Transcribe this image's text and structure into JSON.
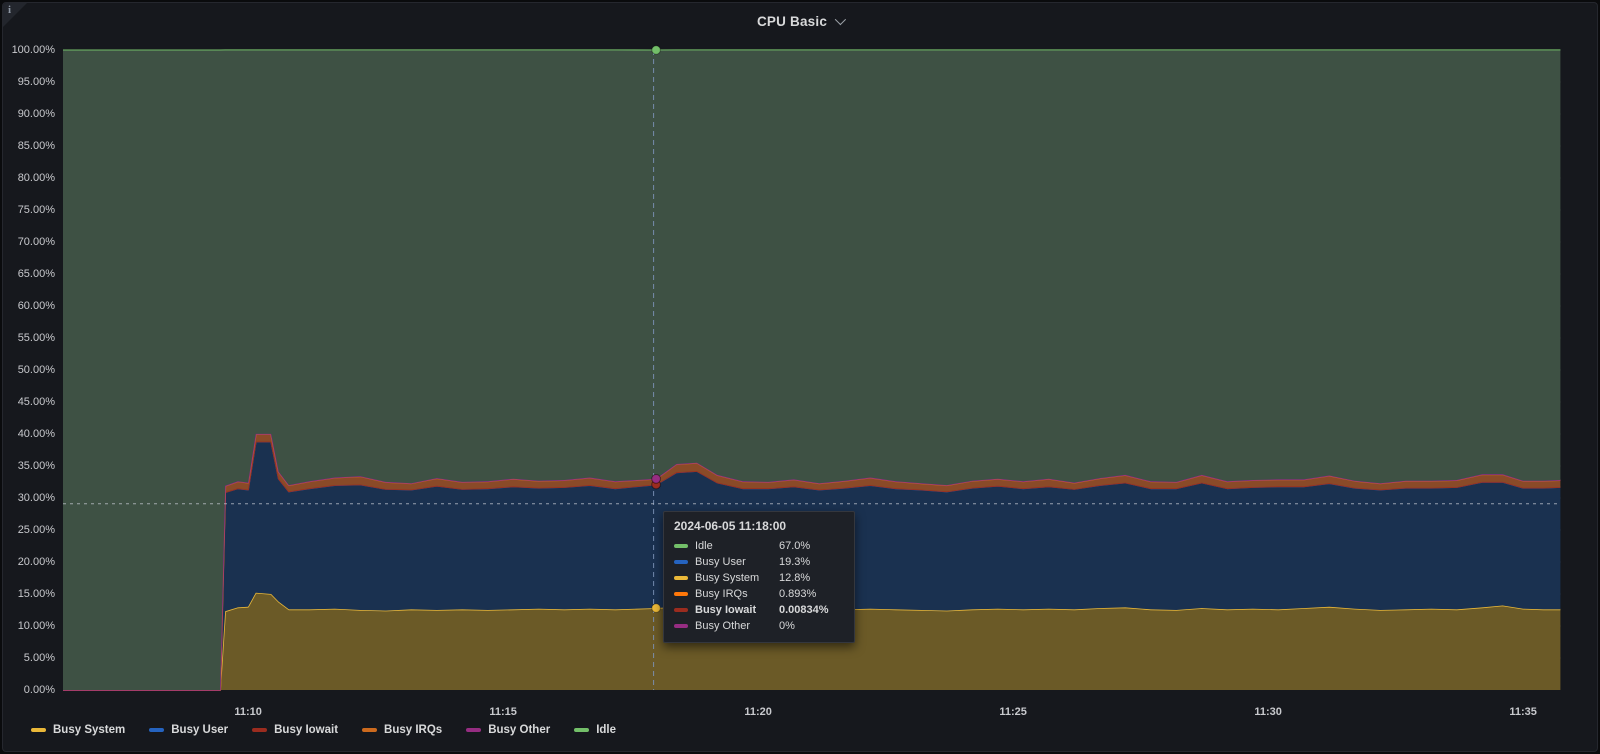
{
  "panel": {
    "title": "CPU Basic",
    "info_icon_text": "i"
  },
  "chart_data": {
    "type": "area",
    "stacked": true,
    "unit": "percent",
    "title": "CPU Basic",
    "ylim": [
      0,
      100
    ],
    "t_domain": [
      6.37,
      35.73
    ],
    "x_ticks": [
      {
        "min": 10,
        "label": "11:10"
      },
      {
        "min": 15,
        "label": "11:15"
      },
      {
        "min": 20,
        "label": "11:20"
      },
      {
        "min": 25,
        "label": "11:25"
      },
      {
        "min": 30,
        "label": "11:30"
      },
      {
        "min": 35,
        "label": "11:35"
      }
    ],
    "y_ticks": [
      {
        "pct": 100,
        "label": "100.00%"
      },
      {
        "pct": 95,
        "label": "95.00%"
      },
      {
        "pct": 90,
        "label": "90.00%"
      },
      {
        "pct": 85,
        "label": "85.00%"
      },
      {
        "pct": 80,
        "label": "80.00%"
      },
      {
        "pct": 75,
        "label": "75.00%"
      },
      {
        "pct": 70,
        "label": "70.00%"
      },
      {
        "pct": 65,
        "label": "65.00%"
      },
      {
        "pct": 60,
        "label": "60.00%"
      },
      {
        "pct": 55,
        "label": "55.00%"
      },
      {
        "pct": 50,
        "label": "50.00%"
      },
      {
        "pct": 45,
        "label": "45.00%"
      },
      {
        "pct": 40,
        "label": "40.00%"
      },
      {
        "pct": 35,
        "label": "35.00%"
      },
      {
        "pct": 30,
        "label": "30.00%"
      },
      {
        "pct": 25,
        "label": "25.00%"
      },
      {
        "pct": 20,
        "label": "20.00%"
      },
      {
        "pct": 15,
        "label": "15.00%"
      },
      {
        "pct": 10,
        "label": "10.00%"
      },
      {
        "pct": 5,
        "label": "5.00%"
      },
      {
        "pct": 0,
        "label": "0.00%"
      }
    ],
    "t": [
      6.37,
      9.45,
      9.55,
      9.8,
      10.0,
      10.15,
      10.45,
      10.6,
      10.8,
      11.2,
      11.7,
      12.2,
      12.7,
      13.2,
      13.7,
      14.2,
      14.7,
      15.2,
      15.7,
      16.2,
      16.7,
      17.2,
      18.0,
      18.4,
      18.8,
      19.2,
      19.7,
      20.2,
      20.7,
      21.2,
      21.7,
      22.2,
      22.7,
      23.2,
      23.7,
      24.2,
      24.7,
      25.2,
      25.7,
      26.2,
      26.7,
      27.2,
      27.7,
      28.2,
      28.7,
      29.2,
      29.7,
      30.2,
      30.7,
      31.2,
      31.7,
      32.2,
      32.7,
      33.2,
      33.7,
      34.2,
      34.6,
      35.0,
      35.4,
      35.73
    ],
    "series": [
      {
        "name": "Busy System",
        "color": "#EAB839",
        "fill": "#6B5A27",
        "line_width": 1.6,
        "values": [
          0,
          0,
          12.3,
          12.9,
          13.0,
          15.2,
          15.0,
          13.8,
          12.6,
          12.6,
          12.7,
          12.5,
          12.4,
          12.6,
          12.5,
          12.6,
          12.5,
          12.6,
          12.7,
          12.6,
          12.7,
          12.6,
          12.8,
          13.0,
          12.9,
          12.8,
          12.6,
          12.5,
          12.6,
          12.5,
          12.6,
          12.7,
          12.6,
          12.5,
          12.4,
          12.6,
          12.7,
          12.6,
          12.7,
          12.6,
          12.8,
          12.9,
          12.6,
          12.5,
          12.8,
          12.6,
          12.7,
          12.6,
          12.8,
          13.0,
          12.7,
          12.5,
          12.6,
          12.7,
          12.6,
          12.9,
          13.2,
          12.7,
          12.6,
          12.6
        ]
      },
      {
        "name": "Busy User",
        "color": "#2563BF",
        "fill": "#1A3150",
        "line_width": 1.6,
        "values": [
          0,
          0,
          18.6,
          18.6,
          18.3,
          23.6,
          23.8,
          19.2,
          18.4,
          18.9,
          19.3,
          19.6,
          19.0,
          18.7,
          19.4,
          18.8,
          19.0,
          19.2,
          18.9,
          19.1,
          19.3,
          18.9,
          19.3,
          21.0,
          21.3,
          19.6,
          18.9,
          19.0,
          19.2,
          18.8,
          19.0,
          19.3,
          18.9,
          18.8,
          18.6,
          19.0,
          19.2,
          18.9,
          19.1,
          18.8,
          19.2,
          19.5,
          18.9,
          19.0,
          19.6,
          18.9,
          19.0,
          19.2,
          19.0,
          19.3,
          18.9,
          18.8,
          19.0,
          18.9,
          19.1,
          19.6,
          19.3,
          18.9,
          19.0,
          19.1
        ]
      },
      {
        "name": "Busy Iowait",
        "color": "#9B2C1F",
        "fill": "#9B2C1F",
        "line_width": 1.6,
        "values": [
          0,
          0,
          0.01,
          0.01,
          0.01,
          0.01,
          0.01,
          0.01,
          0.01,
          0.01,
          0.01,
          0.01,
          0.01,
          0.01,
          0.01,
          0.01,
          0.01,
          0.01,
          0.01,
          0.01,
          0.01,
          0.01,
          0.00834,
          0.01,
          0.01,
          0.01,
          0.01,
          0.01,
          0.01,
          0.01,
          0.01,
          0.01,
          0.01,
          0.01,
          0.01,
          0.01,
          0.01,
          0.01,
          0.01,
          0.01,
          0.01,
          0.01,
          0.01,
          0.01,
          0.01,
          0.01,
          0.01,
          0.01,
          0.01,
          0.01,
          0.01,
          0.01,
          0.01,
          0.01,
          0.01,
          0.01,
          0.01,
          0.01,
          0.01,
          0.01
        ]
      },
      {
        "name": "Busy IRQs",
        "color": "#CC6A1E",
        "fill": "#8A4A28",
        "line_width": 2,
        "values": [
          0,
          0,
          1.0,
          1.1,
          1.1,
          1.2,
          1.2,
          1.1,
          1.0,
          1.1,
          1.2,
          1.3,
          1.1,
          1.0,
          1.2,
          1.1,
          1.1,
          1.2,
          1.1,
          1.1,
          1.2,
          1.1,
          0.893,
          1.3,
          1.3,
          1.2,
          1.1,
          1.0,
          1.1,
          1.0,
          1.1,
          1.2,
          1.1,
          1.0,
          1.0,
          1.1,
          1.1,
          1.1,
          1.2,
          1.0,
          1.1,
          1.2,
          1.1,
          1.0,
          1.2,
          1.1,
          1.1,
          1.1,
          1.1,
          1.2,
          1.1,
          1.0,
          1.1,
          1.1,
          1.1,
          1.2,
          1.2,
          1.1,
          1.1,
          1.1
        ]
      },
      {
        "name": "Busy Other",
        "color": "#962D82",
        "fill": "#962D82",
        "line_width": 1.4,
        "values": [
          0,
          0,
          0,
          0,
          0,
          0,
          0,
          0,
          0,
          0,
          0,
          0,
          0,
          0,
          0,
          0,
          0,
          0,
          0,
          0,
          0,
          0,
          0,
          0,
          0,
          0,
          0,
          0,
          0,
          0,
          0,
          0,
          0,
          0,
          0,
          0,
          0,
          0,
          0,
          0,
          0,
          0,
          0,
          0,
          0,
          0,
          0,
          0,
          0,
          0,
          0,
          0,
          0,
          0,
          0,
          0,
          0,
          0,
          0,
          0
        ]
      },
      {
        "name": "Idle",
        "color": "#73BF69",
        "fill": "#3E5144",
        "line_width": 1.3,
        "line_opacity": 0.8,
        "values": [
          100,
          100,
          68.1,
          67.4,
          67.6,
          60.0,
          60.0,
          65.9,
          68.0,
          67.4,
          66.8,
          66.6,
          67.5,
          67.7,
          66.9,
          67.5,
          67.4,
          67.0,
          67.3,
          67.2,
          66.8,
          67.4,
          67.0,
          64.7,
          64.5,
          66.4,
          67.4,
          67.5,
          67.1,
          67.7,
          67.3,
          66.8,
          67.4,
          67.7,
          68.0,
          67.3,
          67.0,
          67.4,
          67.0,
          67.6,
          66.9,
          66.4,
          67.4,
          67.5,
          66.4,
          67.4,
          67.2,
          67.1,
          67.1,
          66.5,
          67.3,
          67.7,
          67.3,
          67.3,
          67.2,
          66.3,
          66.3,
          67.3,
          67.3,
          67.2
        ]
      }
    ],
    "legend_order": [
      "Busy System",
      "Busy User",
      "Busy Iowait",
      "Busy IRQs",
      "Busy Other",
      "Idle"
    ]
  },
  "cursor": {
    "snap_time_min": 18.0,
    "mouse_time_min": 17.95,
    "mouse_value_pct": 29.1
  },
  "tooltip": {
    "timestamp": "2024-06-05 11:18:00",
    "rows": [
      {
        "name": "Idle",
        "value": "67.0%",
        "color": "#73BF69",
        "bold": false
      },
      {
        "name": "Busy User",
        "value": "19.3%",
        "color": "#2563BF",
        "bold": false
      },
      {
        "name": "Busy System",
        "value": "12.8%",
        "color": "#EAB839",
        "bold": false
      },
      {
        "name": "Busy IRQs",
        "value": "0.893%",
        "color": "#FF780A",
        "bold": false
      },
      {
        "name": "Busy Iowait",
        "value": "0.00834%",
        "color": "#9B2C1F",
        "bold": true
      },
      {
        "name": "Busy Other",
        "value": "0%",
        "color": "#962D82",
        "bold": false
      }
    ]
  }
}
